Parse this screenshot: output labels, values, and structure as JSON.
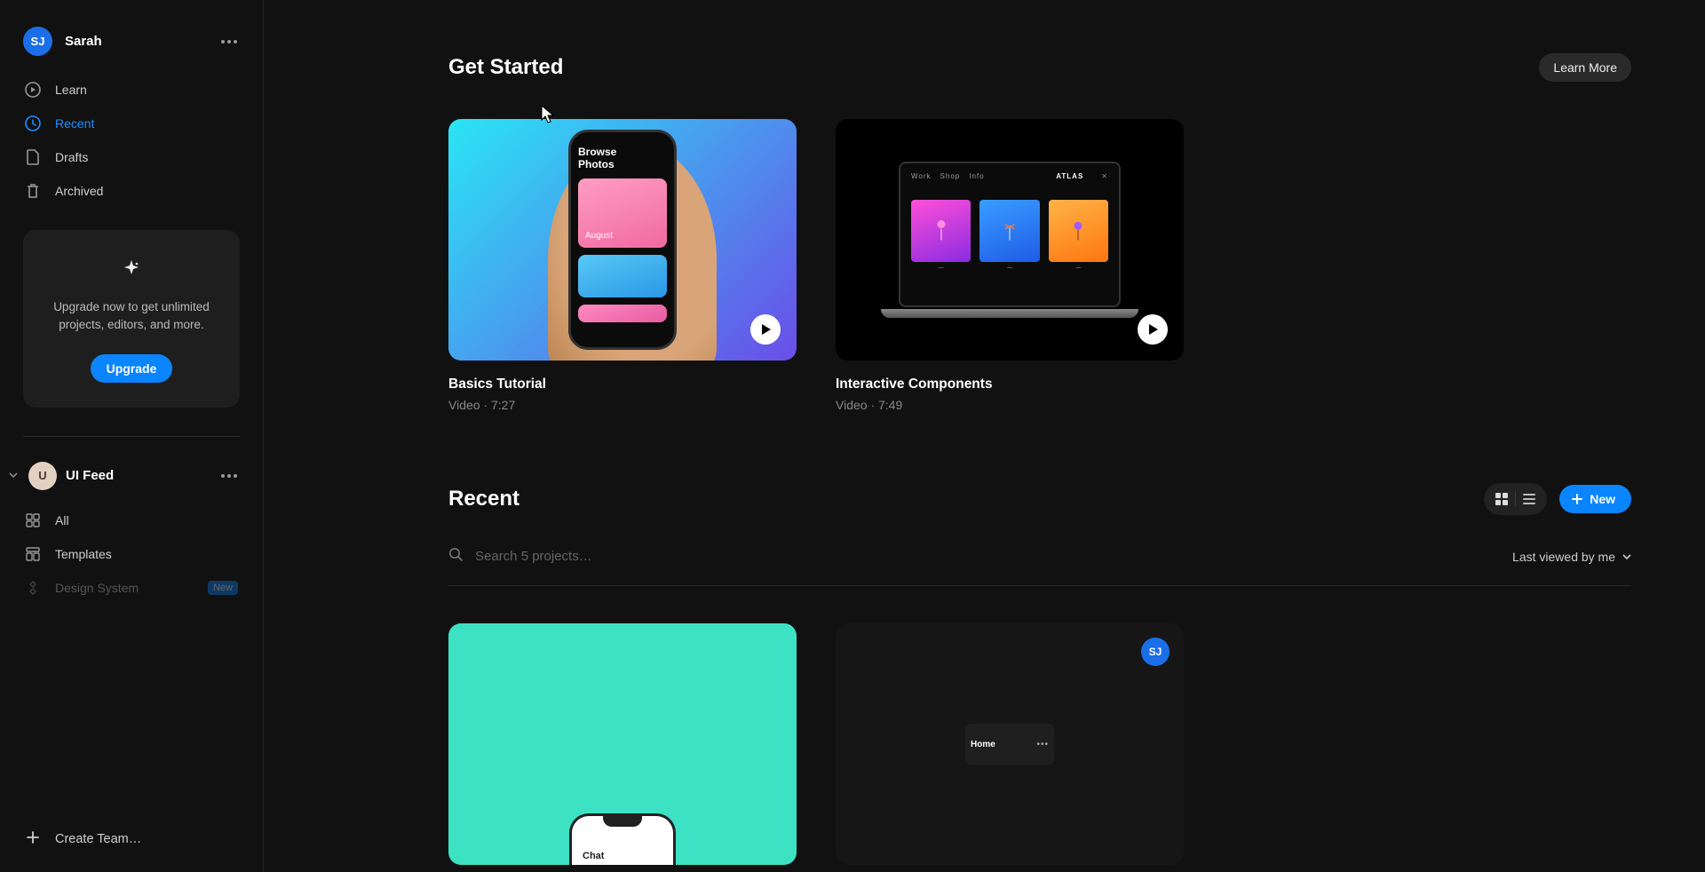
{
  "user": {
    "name": "Sarah",
    "initials": "SJ"
  },
  "sidebar": {
    "nav": [
      {
        "label": "Learn",
        "icon": "play"
      },
      {
        "label": "Recent",
        "icon": "clock"
      },
      {
        "label": "Drafts",
        "icon": "file"
      },
      {
        "label": "Archived",
        "icon": "trash"
      }
    ],
    "upgrade": {
      "text": "Upgrade now to get unlimited projects, editors, and more.",
      "button": "Upgrade"
    },
    "team": {
      "name": "UI Feed",
      "initials": "U",
      "items": [
        {
          "label": "All",
          "icon": "grid"
        },
        {
          "label": "Templates",
          "icon": "template"
        },
        {
          "label": "Design System",
          "icon": "component",
          "badge": "New"
        }
      ]
    },
    "createTeam": "Create Team…"
  },
  "getStarted": {
    "title": "Get Started",
    "learnMore": "Learn More",
    "videos": [
      {
        "title": "Basics Tutorial",
        "meta": "Video · 7:27",
        "thumb": {
          "phoneTitle": "Browse\nPhotos",
          "tileCaption": "August"
        }
      },
      {
        "title": "Interactive Components",
        "meta": "Video · 7:49",
        "thumb": {
          "nav": [
            "Work",
            "Shop",
            "Info"
          ],
          "brand": "ATLAS"
        }
      }
    ]
  },
  "recent": {
    "title": "Recent",
    "newLabel": "New",
    "searchPlaceholder": "Search 5 projects…",
    "sortLabel": "Last viewed by me",
    "projects": [
      {
        "thumbLabel": "Chat"
      },
      {
        "thumbLabel": "Home",
        "avatarInitials": "SJ"
      }
    ]
  }
}
